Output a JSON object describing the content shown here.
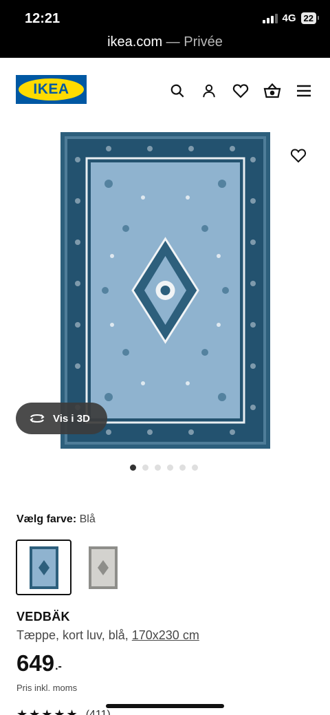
{
  "status_bar": {
    "time": "12:21",
    "network": "4G",
    "battery": "22"
  },
  "browser": {
    "domain": "ikea.com",
    "mode": " — Privée"
  },
  "header": {
    "logo_text": "IKEA",
    "icons": [
      "search-icon",
      "user-icon",
      "heart-icon",
      "basket-icon",
      "menu-icon"
    ]
  },
  "gallery": {
    "view_3d_label": "Vis i 3D",
    "dots_total": 6,
    "dots_active": 1
  },
  "color_picker": {
    "label": "Vælg farve:",
    "selected": "Blå",
    "options": [
      "blue",
      "grey"
    ]
  },
  "product": {
    "name": "VEDBÄK",
    "description": "Tæppe, kort luv, blå, ",
    "size": "170x230 cm",
    "price": "649",
    "price_suffix": ".-",
    "price_note": "Pris inkl. moms",
    "stars": "★★★★★",
    "reviews": "(411)"
  },
  "colors": {
    "brand_blue": "#0058a3",
    "brand_yellow": "#ffdb00",
    "rug_field": "#8fb3cf",
    "rug_border": "#2d5f7c"
  }
}
